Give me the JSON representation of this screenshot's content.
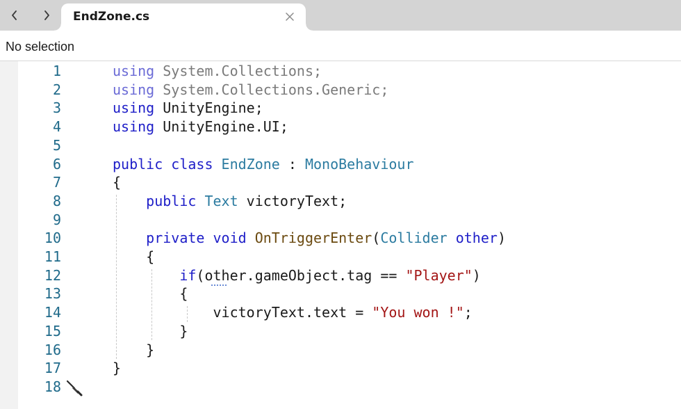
{
  "tabbar": {
    "back_icon": "chevron-left-icon",
    "forward_icon": "chevron-right-icon",
    "tab_title": "EndZone.cs",
    "close_icon": "close-icon"
  },
  "status": {
    "selection": "No selection"
  },
  "editor": {
    "lines": [
      {
        "n": "1",
        "tokens": [
          [
            "kwfade",
            "using"
          ],
          [
            "nsfade",
            " System.Collections;"
          ]
        ]
      },
      {
        "n": "2",
        "tokens": [
          [
            "kwfade",
            "using"
          ],
          [
            "nsfade",
            " System.Collections.Generic;"
          ]
        ]
      },
      {
        "n": "3",
        "tokens": [
          [
            "kw",
            "using"
          ],
          [
            "plain",
            " UnityEngine;"
          ]
        ]
      },
      {
        "n": "4",
        "tokens": [
          [
            "kw",
            "using"
          ],
          [
            "plain",
            " UnityEngine.UI;"
          ]
        ]
      },
      {
        "n": "5",
        "tokens": []
      },
      {
        "n": "6",
        "tokens": [
          [
            "kw",
            "public class"
          ],
          [
            "plain",
            " "
          ],
          [
            "type",
            "EndZone"
          ],
          [
            "plain",
            " : "
          ],
          [
            "type",
            "MonoBehaviour"
          ]
        ]
      },
      {
        "n": "7",
        "tokens": [
          [
            "plain",
            "{"
          ]
        ]
      },
      {
        "n": "8",
        "tokens": [
          [
            "plain",
            "    "
          ],
          [
            "kw",
            "public"
          ],
          [
            "plain",
            " "
          ],
          [
            "type",
            "Text"
          ],
          [
            "plain",
            " victoryText;"
          ]
        ]
      },
      {
        "n": "9",
        "tokens": []
      },
      {
        "n": "10",
        "tokens": [
          [
            "plain",
            "    "
          ],
          [
            "kw",
            "private void"
          ],
          [
            "plain",
            " "
          ],
          [
            "method",
            "OnTriggerEnter"
          ],
          [
            "plain",
            "("
          ],
          [
            "type",
            "Collider"
          ],
          [
            "plain",
            " "
          ],
          [
            "kw",
            "other"
          ],
          [
            "plain",
            ")"
          ]
        ]
      },
      {
        "n": "11",
        "tokens": [
          [
            "plain",
            "    {"
          ]
        ]
      },
      {
        "n": "12",
        "tokens": [
          [
            "plain",
            "        "
          ],
          [
            "kw",
            "if"
          ],
          [
            "plain",
            "(other.gameObject.tag == "
          ],
          [
            "str",
            "\"Player\""
          ],
          [
            "plain",
            ")"
          ]
        ]
      },
      {
        "n": "13",
        "tokens": [
          [
            "plain",
            "        {"
          ]
        ]
      },
      {
        "n": "14",
        "tokens": [
          [
            "plain",
            "            victoryText.text = "
          ],
          [
            "str",
            "\"You won !\""
          ],
          [
            "plain",
            ";"
          ]
        ]
      },
      {
        "n": "15",
        "tokens": [
          [
            "plain",
            "        }"
          ]
        ]
      },
      {
        "n": "16",
        "tokens": [
          [
            "plain",
            "    }"
          ]
        ]
      },
      {
        "n": "17",
        "tokens": [
          [
            "plain",
            "}"
          ]
        ]
      },
      {
        "n": "18",
        "tokens": []
      }
    ],
    "caret_icon": "screwdriver-icon"
  },
  "colors": {
    "keyword": "#1e1ec8",
    "type": "#2b7ba0",
    "method": "#6b4a10",
    "string": "#a31515",
    "line_number": "#1f6a8a"
  }
}
